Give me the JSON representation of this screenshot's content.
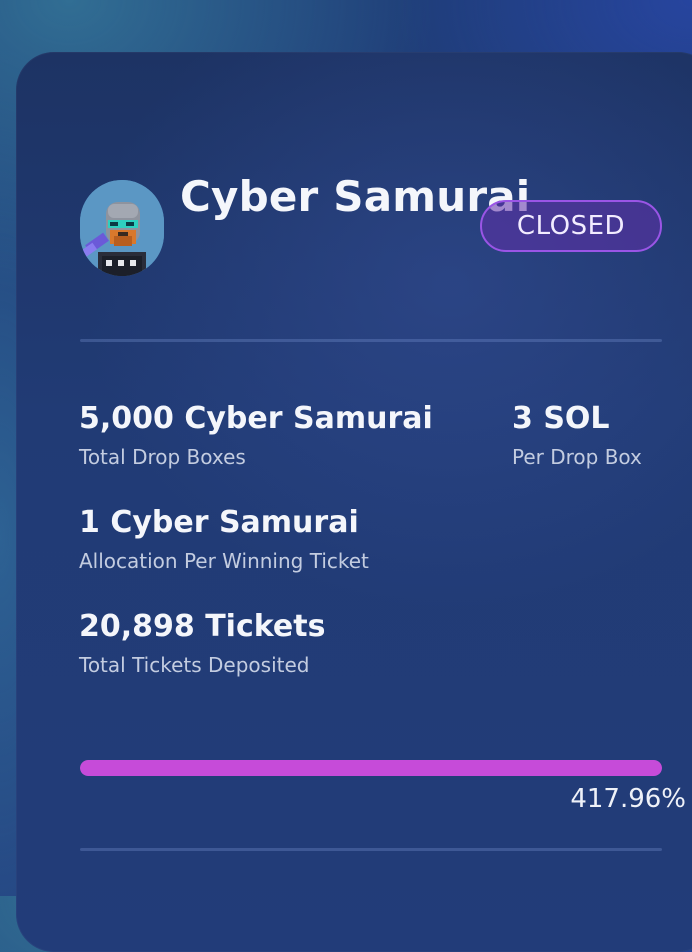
{
  "collection": {
    "name": "Cyber Samurai",
    "status": "CLOSED",
    "status_color": "#9a55e6",
    "avatar_icon": "cyber-samurai-avatar"
  },
  "stats": [
    {
      "value": "5,000 Cyber Samurai",
      "label": "Total Drop Boxes"
    },
    {
      "value": "3 SOL",
      "label": "Per Drop Box"
    },
    {
      "value": "1 Cyber Samurai",
      "label": "Allocation Per Winning Ticket"
    },
    {
      "value": "20,898 Tickets",
      "label": "Total Tickets Deposited"
    }
  ],
  "progress": {
    "percent_label": "417.96%",
    "fill_fraction": 1.0,
    "fill_color": "#c64bd9"
  }
}
